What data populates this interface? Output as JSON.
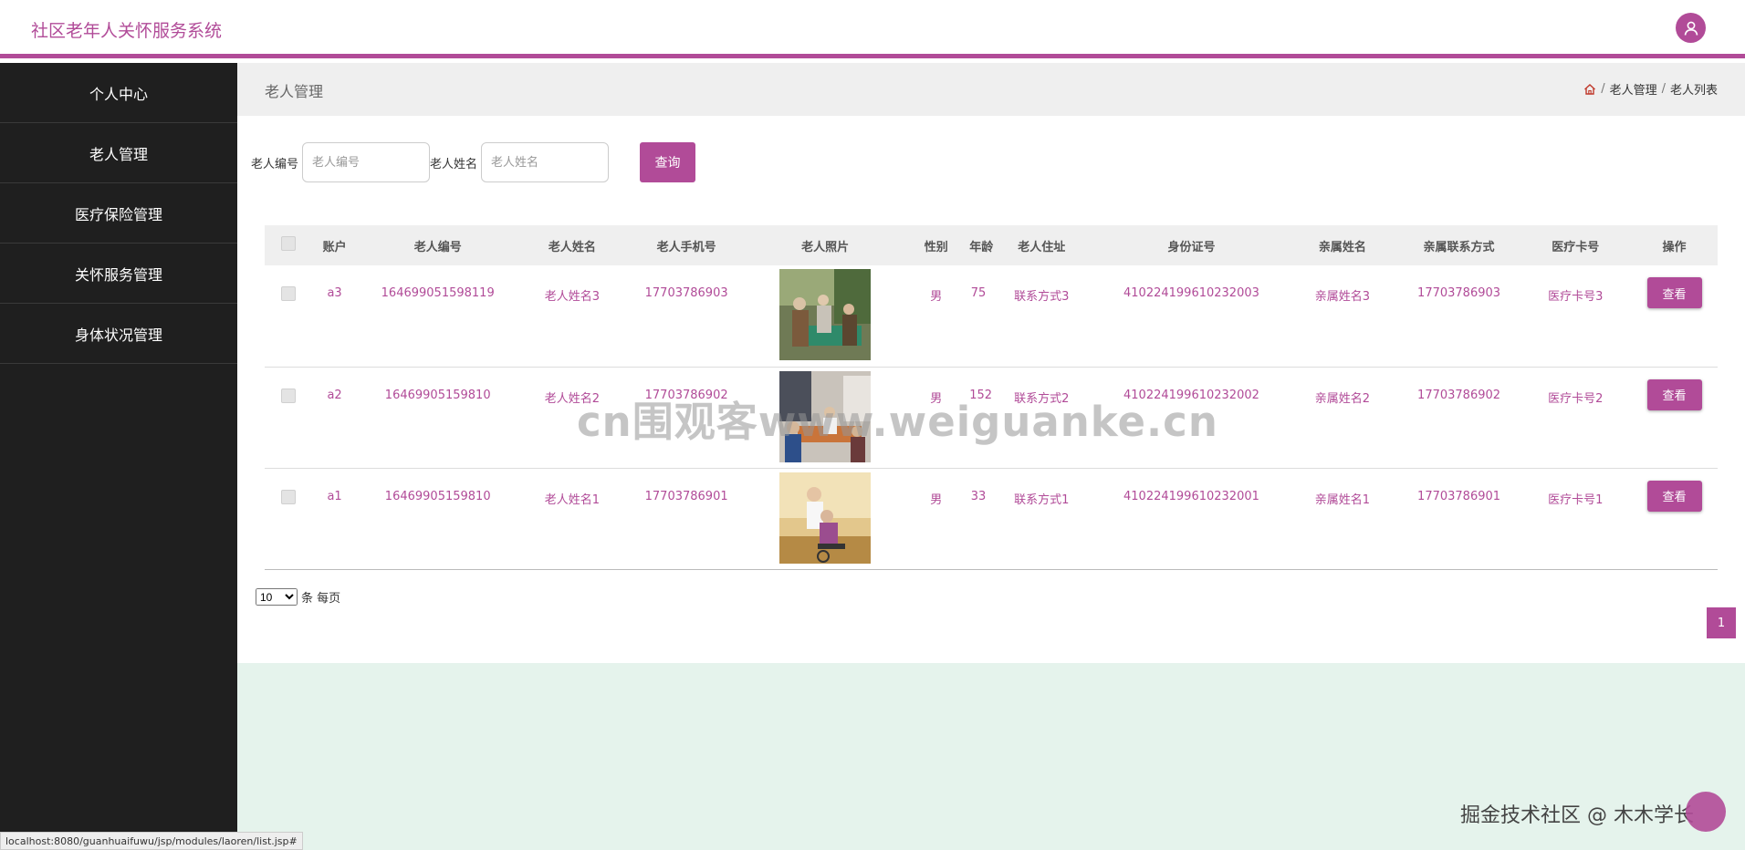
{
  "header": {
    "title": "社区老年人关怀服务系统",
    "avatar_icon": "user-icon"
  },
  "sidebar": {
    "items": [
      {
        "label": "个人中心"
      },
      {
        "label": "老人管理"
      },
      {
        "label": "医疗保险管理"
      },
      {
        "label": "关怀服务管理"
      },
      {
        "label": "身体状况管理"
      }
    ]
  },
  "page": {
    "title": "老人管理",
    "breadcrumb": {
      "home_icon": "home-icon",
      "sep1": "/",
      "level1": "老人管理",
      "sep2": "/",
      "level2": "老人列表"
    }
  },
  "search": {
    "field1": {
      "label": "老人编号",
      "placeholder": "老人编号",
      "value": ""
    },
    "field2": {
      "label": "老人姓名",
      "placeholder": "老人姓名",
      "value": ""
    },
    "button": "查询"
  },
  "table": {
    "headers": [
      "账户",
      "老人编号",
      "老人姓名",
      "老人手机号",
      "老人照片",
      "性别",
      "年龄",
      "老人住址",
      "身份证号",
      "亲属姓名",
      "亲属联系方式",
      "医疗卡号",
      "操作"
    ],
    "rows": [
      {
        "account": "a3",
        "number": "164699051598119",
        "name": "老人姓名3",
        "phone": "17703786903",
        "gender": "男",
        "age": "75",
        "address": "联系方式3",
        "id_card": "410224199610232003",
        "relative_name": "亲属姓名3",
        "relative_contact": "17703786903",
        "medical_card": "医疗卡号3",
        "action": "查看"
      },
      {
        "account": "a2",
        "number": "16469905159810",
        "name": "老人姓名2",
        "phone": "17703786902",
        "gender": "男",
        "age": "152",
        "address": "联系方式2",
        "id_card": "410224199610232002",
        "relative_name": "亲属姓名2",
        "relative_contact": "17703786902",
        "medical_card": "医疗卡号2",
        "action": "查看"
      },
      {
        "account": "a1",
        "number": "16469905159810",
        "name": "老人姓名1",
        "phone": "17703786901",
        "gender": "男",
        "age": "33",
        "address": "联系方式1",
        "id_card": "410224199610232001",
        "relative_name": "亲属姓名1",
        "relative_contact": "17703786901",
        "medical_card": "医疗卡号1",
        "action": "查看"
      }
    ]
  },
  "pagination": {
    "page_size": "10",
    "page_size_suffix": "条 每页",
    "current_page": "1"
  },
  "overlays": {
    "watermark": "cn围观客www.weiguanke.cn",
    "footer_watermark": "掘金技术社区 @ 木木学长",
    "status_url": "localhost:8080/guanhuaifuwu/jsp/modules/laoren/list.jsp#"
  },
  "colors": {
    "accent": "#b14b98",
    "sidebar_bg": "#1f1f1f",
    "main_bg": "#e5f3ec"
  }
}
